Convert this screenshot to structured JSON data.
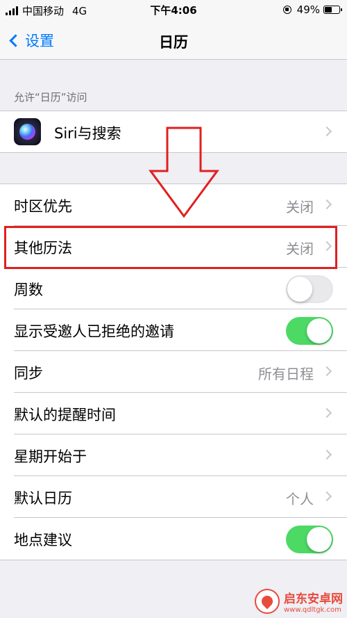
{
  "status_bar": {
    "carrier": "中国移动",
    "network": "4G",
    "time": "下午4:06",
    "battery_percent": "49%",
    "battery_level": 0.49
  },
  "nav": {
    "back_label": "设置",
    "title": "日历"
  },
  "sections": {
    "access_header": "允许“日历”访问"
  },
  "siri_row": {
    "label": "Siri与搜索"
  },
  "settings": {
    "timezone_override": {
      "label": "时区优先",
      "value": "关闭"
    },
    "alternate_calendars": {
      "label": "其他历法",
      "value": "关闭"
    },
    "week_numbers": {
      "label": "周数",
      "enabled": false
    },
    "show_declined": {
      "label": "显示受邀人已拒绝的邀请",
      "enabled": true
    },
    "sync": {
      "label": "同步",
      "value": "所有日程"
    },
    "default_alert_times": {
      "label": "默认的提醒时间"
    },
    "start_week_on": {
      "label": "星期开始于"
    },
    "default_calendar": {
      "label": "默认日历",
      "value": "个人"
    },
    "location_suggestions": {
      "label": "地点建议",
      "enabled": true
    }
  },
  "watermark": {
    "title": "启东安卓网",
    "url": "www.qdltgk.com"
  },
  "colors": {
    "accent": "#007aff",
    "toggle_on": "#4cd964",
    "annotation_red": "#e02020"
  }
}
